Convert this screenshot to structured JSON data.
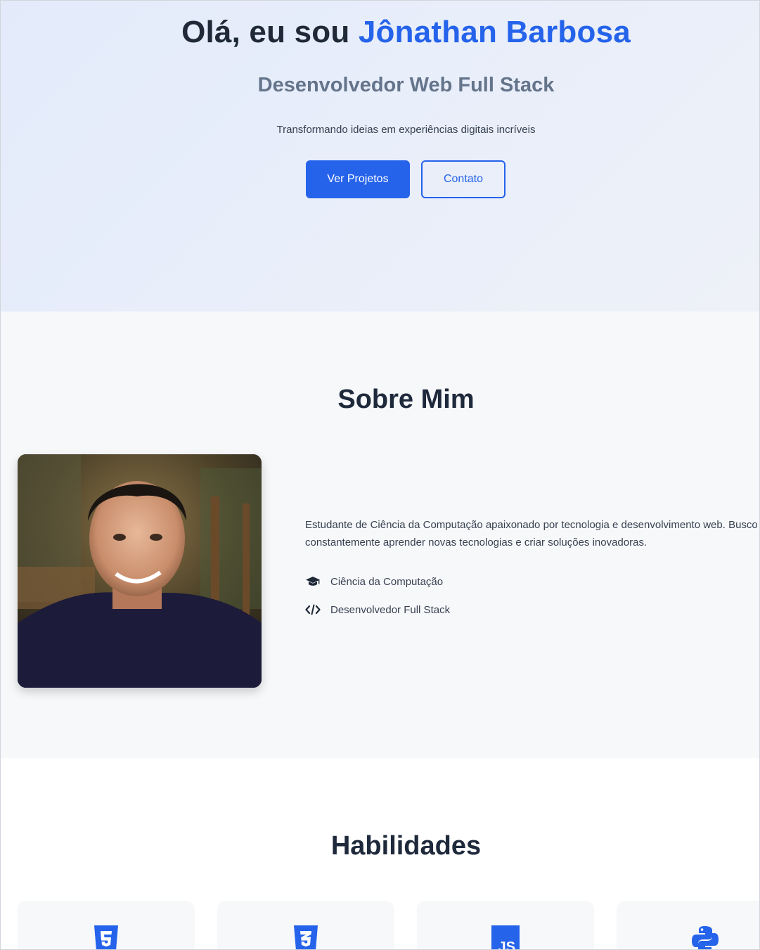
{
  "hero": {
    "greeting": "Olá, eu sou ",
    "name": "Jônathan Barbosa",
    "subtitle": "Desenvolvedor Web Full Stack",
    "tagline": "Transformando ideias em experiências digitais incríveis",
    "primary_button": "Ver Projetos",
    "secondary_button": "Contato"
  },
  "about": {
    "title": "Sobre Mim",
    "description_line1": "Estudante de Ciência da Computação apaixonado por tecnologia e desenvolvimento web. Busco",
    "description_line2": "constantemente aprender novas tecnologias e criar soluções inovadoras.",
    "items": [
      {
        "icon": "graduation-cap-icon",
        "label": "Ciência da Computação"
      },
      {
        "icon": "code-icon",
        "label": "Desenvolvedor Full Stack"
      }
    ]
  },
  "skills": {
    "title": "Habilidades",
    "cards": [
      {
        "icon": "html5-icon"
      },
      {
        "icon": "css3-icon"
      },
      {
        "icon": "javascript-icon",
        "badge": "JS"
      },
      {
        "icon": "python-icon"
      }
    ]
  },
  "colors": {
    "accent": "#2563eb",
    "heading": "#1e293b",
    "subtitle": "#64748b"
  }
}
